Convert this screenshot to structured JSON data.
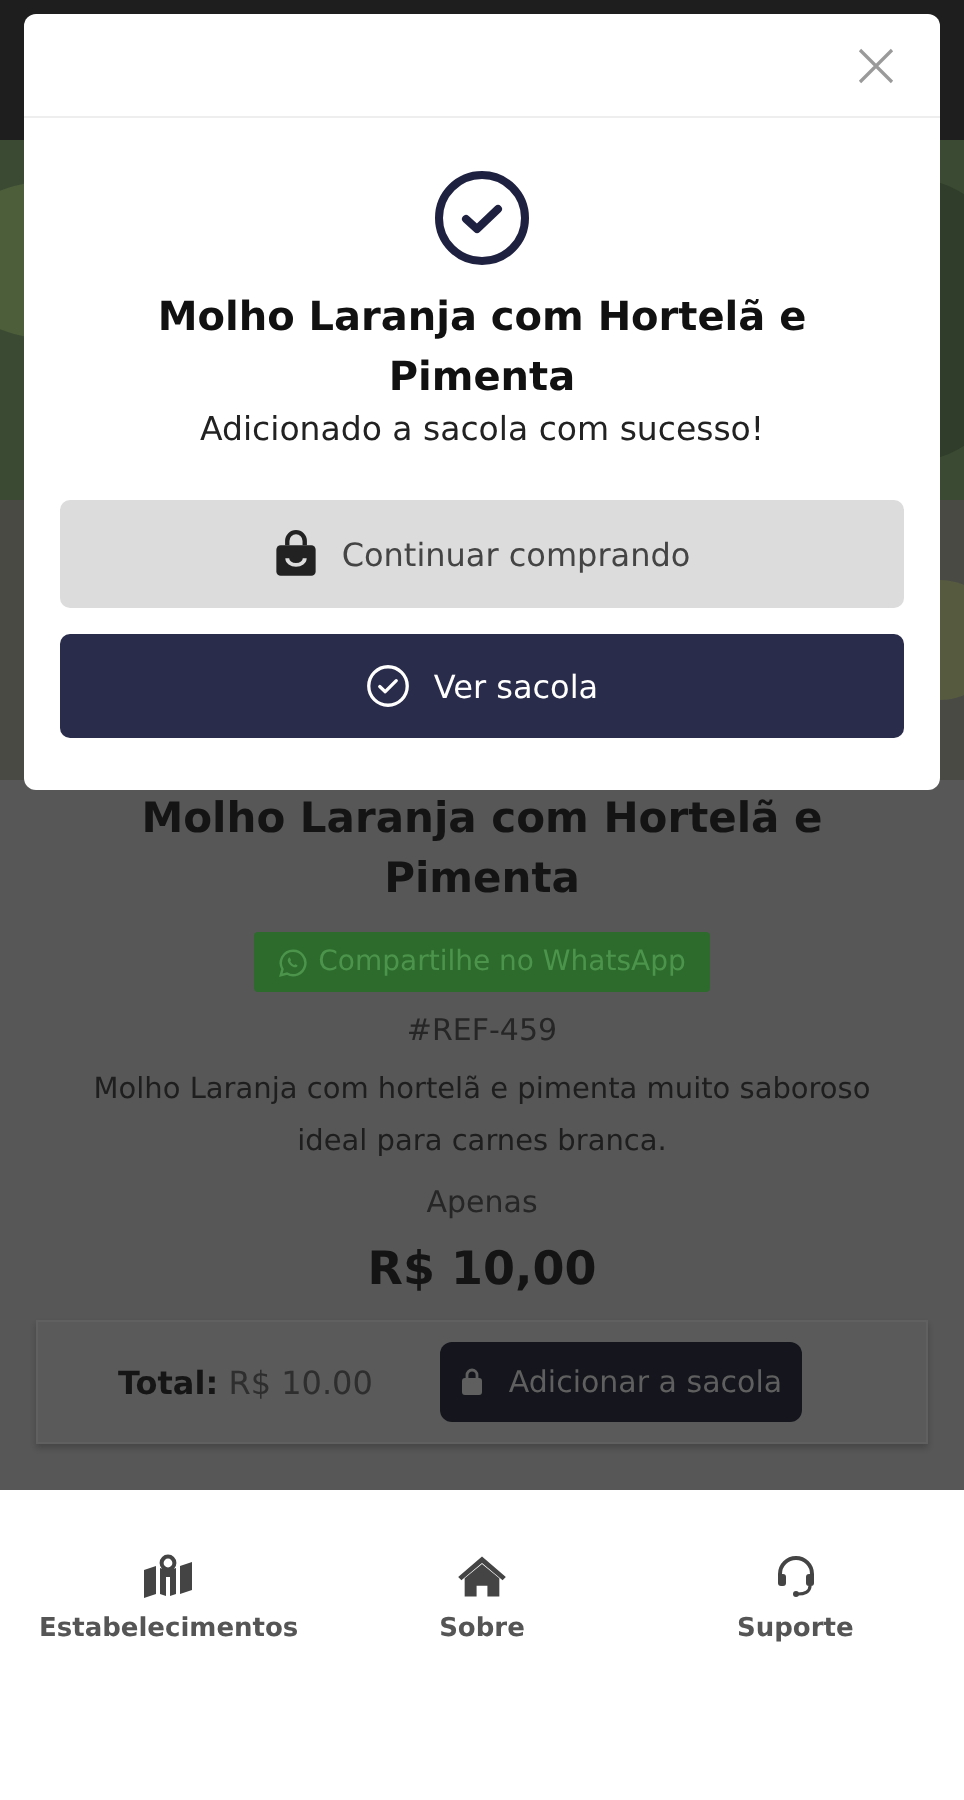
{
  "product": {
    "title": "Molho Laranja com Hortelã e Pimenta",
    "share_button": "Compartilhe no WhatsApp",
    "ref": "#REF-459",
    "description": "Molho Laranja com hortelã e pimenta muito saboroso ideal para carnes branca.",
    "price_label": "Apenas",
    "price": "R$ 10,00"
  },
  "cart_bar": {
    "total_label": "Total:",
    "total_value": "R$ 10.00",
    "add_button": "Adicionar a sacola"
  },
  "modal": {
    "title": "Molho Laranja com Hortelã e Pimenta",
    "message": "Adicionado a sacola com sucesso!",
    "buttons": [
      {
        "kind": "secondary",
        "label": "Continuar comprando"
      },
      {
        "kind": "primary",
        "label": "Ver sacola"
      }
    ]
  },
  "bottom_nav": [
    {
      "kind": "map",
      "label": "Estabelecimentos"
    },
    {
      "kind": "home",
      "label": "Sobre"
    },
    {
      "kind": "support",
      "label": "Suporte"
    }
  ]
}
